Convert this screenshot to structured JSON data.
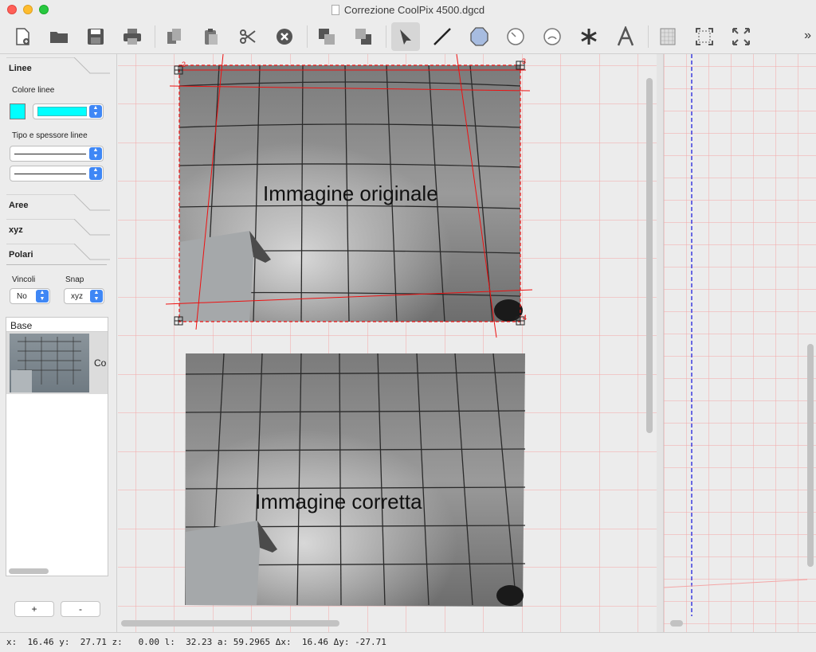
{
  "window": {
    "title": "Correzione CoolPix 4500.dgcd"
  },
  "toolbar": {
    "icons": [
      "new-document-icon",
      "open-folder-icon",
      "save-icon",
      "print-icon",
      "copy-icon",
      "paste-icon",
      "cut-icon",
      "delete-icon",
      "bring-front-icon",
      "send-back-icon",
      "arrow-pointer-icon",
      "line-tool-icon",
      "polygon-tool-icon",
      "circle-tool-icon",
      "arc-tool-icon",
      "point-tool-icon",
      "text-tool-icon",
      "grid-icon",
      "fit-selection-icon",
      "fullscreen-icon"
    ],
    "more": "»"
  },
  "left_panel": {
    "linee_title": "Linee",
    "colore_label": "Colore linee",
    "line_color": "#00ffff",
    "tipo_label": "Tipo e spessore linee",
    "aree_title": "Aree",
    "xyz_title": "xyz",
    "polari_title": "Polari",
    "vincoli_label": "Vincoli",
    "snap_label": "Snap",
    "vincoli_value": "No",
    "snap_value": "xyz",
    "layers_header": "Base",
    "layer_name": "Co",
    "add_button": "+",
    "remove_button": "-"
  },
  "canvas": {
    "label_original": "Immagine originale",
    "label_corrected": "Immagine corretta",
    "corner_labels": [
      "2",
      "3",
      "4"
    ]
  },
  "statusbar": {
    "text": "x:  16.46 y:  27.71 z:   0.00 l:  32.23 a: 59.2965 Δx:  16.46 Δy: -27.71"
  },
  "colors": {
    "grid": "#f4a6a6",
    "marker": "#e11",
    "axis": "#2222dd"
  }
}
